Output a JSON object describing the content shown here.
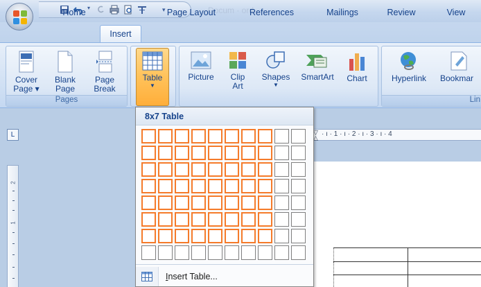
{
  "window": {
    "title_faded": "Docum  ·  ord"
  },
  "tabs": [
    {
      "label": "Home"
    },
    {
      "label": "Insert",
      "active": true
    },
    {
      "label": "Page Layout"
    },
    {
      "label": "References"
    },
    {
      "label": "Mailings"
    },
    {
      "label": "Review"
    },
    {
      "label": "View"
    }
  ],
  "ribbon": {
    "pages_group": {
      "label": "Pages",
      "buttons": [
        {
          "line1": "Cover",
          "line2": "Page ▾",
          "icon": "cover-page-icon"
        },
        {
          "line1": "Blank",
          "line2": "Page",
          "icon": "blank-page-icon"
        },
        {
          "line1": "Page",
          "line2": "Break",
          "icon": "page-break-icon"
        }
      ]
    },
    "tables_group": {
      "button": {
        "line1": "Table",
        "icon": "table-icon"
      }
    },
    "illustrations_group": {
      "buttons": [
        {
          "line1": "Picture",
          "icon": "picture-icon"
        },
        {
          "line1": "Clip",
          "line2": "Art",
          "icon": "clip-art-icon"
        },
        {
          "line1": "Shapes",
          "icon": "shapes-icon"
        },
        {
          "line1": "SmartArt",
          "icon": "smartart-icon"
        },
        {
          "line1": "Chart",
          "icon": "chart-icon"
        }
      ]
    },
    "links_group": {
      "label": "Lin",
      "buttons": [
        {
          "line1": "Hyperlink",
          "icon": "hyperlink-icon"
        },
        {
          "line1": "Bookmar",
          "icon": "bookmark-icon"
        }
      ]
    }
  },
  "table_dropdown": {
    "header": "8x7 Table",
    "grid": {
      "columns": 10,
      "rows": 8,
      "selected_columns": 8,
      "selected_rows": 7
    },
    "insert_table_label": "Insert Table..."
  },
  "ruler": {
    "corner_glyph": "L",
    "horizontal_text": "· ı · 1 · ı · 2 · ı · 3 · ı · 4",
    "vertical_numbers": [
      "2",
      "1"
    ]
  },
  "colors": {
    "selection_orange": "#f57b2a",
    "ribbon_text": "#15428b"
  }
}
